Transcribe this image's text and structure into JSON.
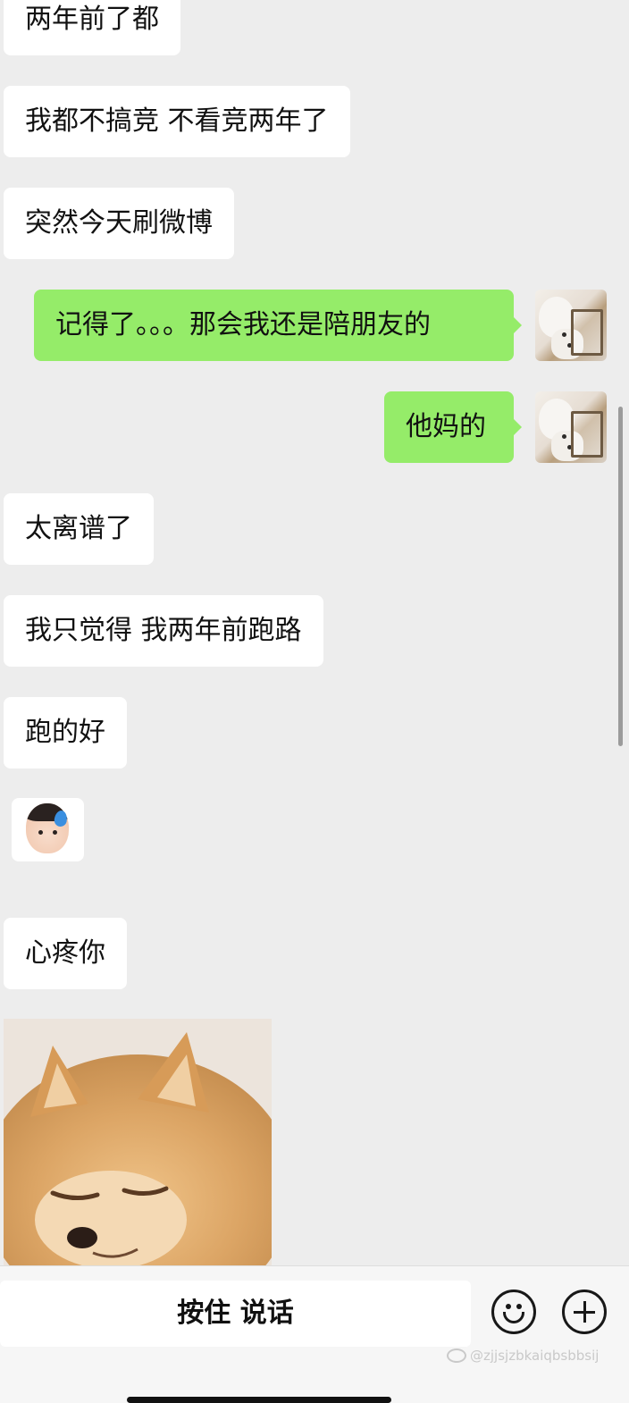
{
  "messages": [
    {
      "direction": "in",
      "text": "两年前了都"
    },
    {
      "direction": "in",
      "text": "我都不搞竞 不看竞两年了"
    },
    {
      "direction": "in",
      "text": "突然今天刷微博"
    },
    {
      "direction": "out",
      "text": "记得了。。。那会我还是陪朋友的"
    },
    {
      "direction": "out",
      "text": "他妈的"
    },
    {
      "direction": "in",
      "text": "太离谱了"
    },
    {
      "direction": "in",
      "text": "我只觉得 我两年前跑路"
    },
    {
      "direction": "in",
      "text": "跑的好"
    },
    {
      "direction": "in",
      "type": "sticker",
      "sticker": "baby-sweat-sticker"
    },
    {
      "direction": "in",
      "text": "心疼你"
    },
    {
      "direction": "in",
      "type": "image",
      "image": "pomeranian-dog-image"
    }
  ],
  "input_bar": {
    "talk_button_label": "按住 说话",
    "emoji_icon": "emoji-icon",
    "more_icon": "plus-icon"
  },
  "watermark": {
    "text": "@zjjsjzbkaiqbsbbsij",
    "icon": "weibo-icon"
  },
  "colors": {
    "background": "#ededed",
    "incoming_bubble": "#ffffff",
    "outgoing_bubble": "#95ec69"
  }
}
